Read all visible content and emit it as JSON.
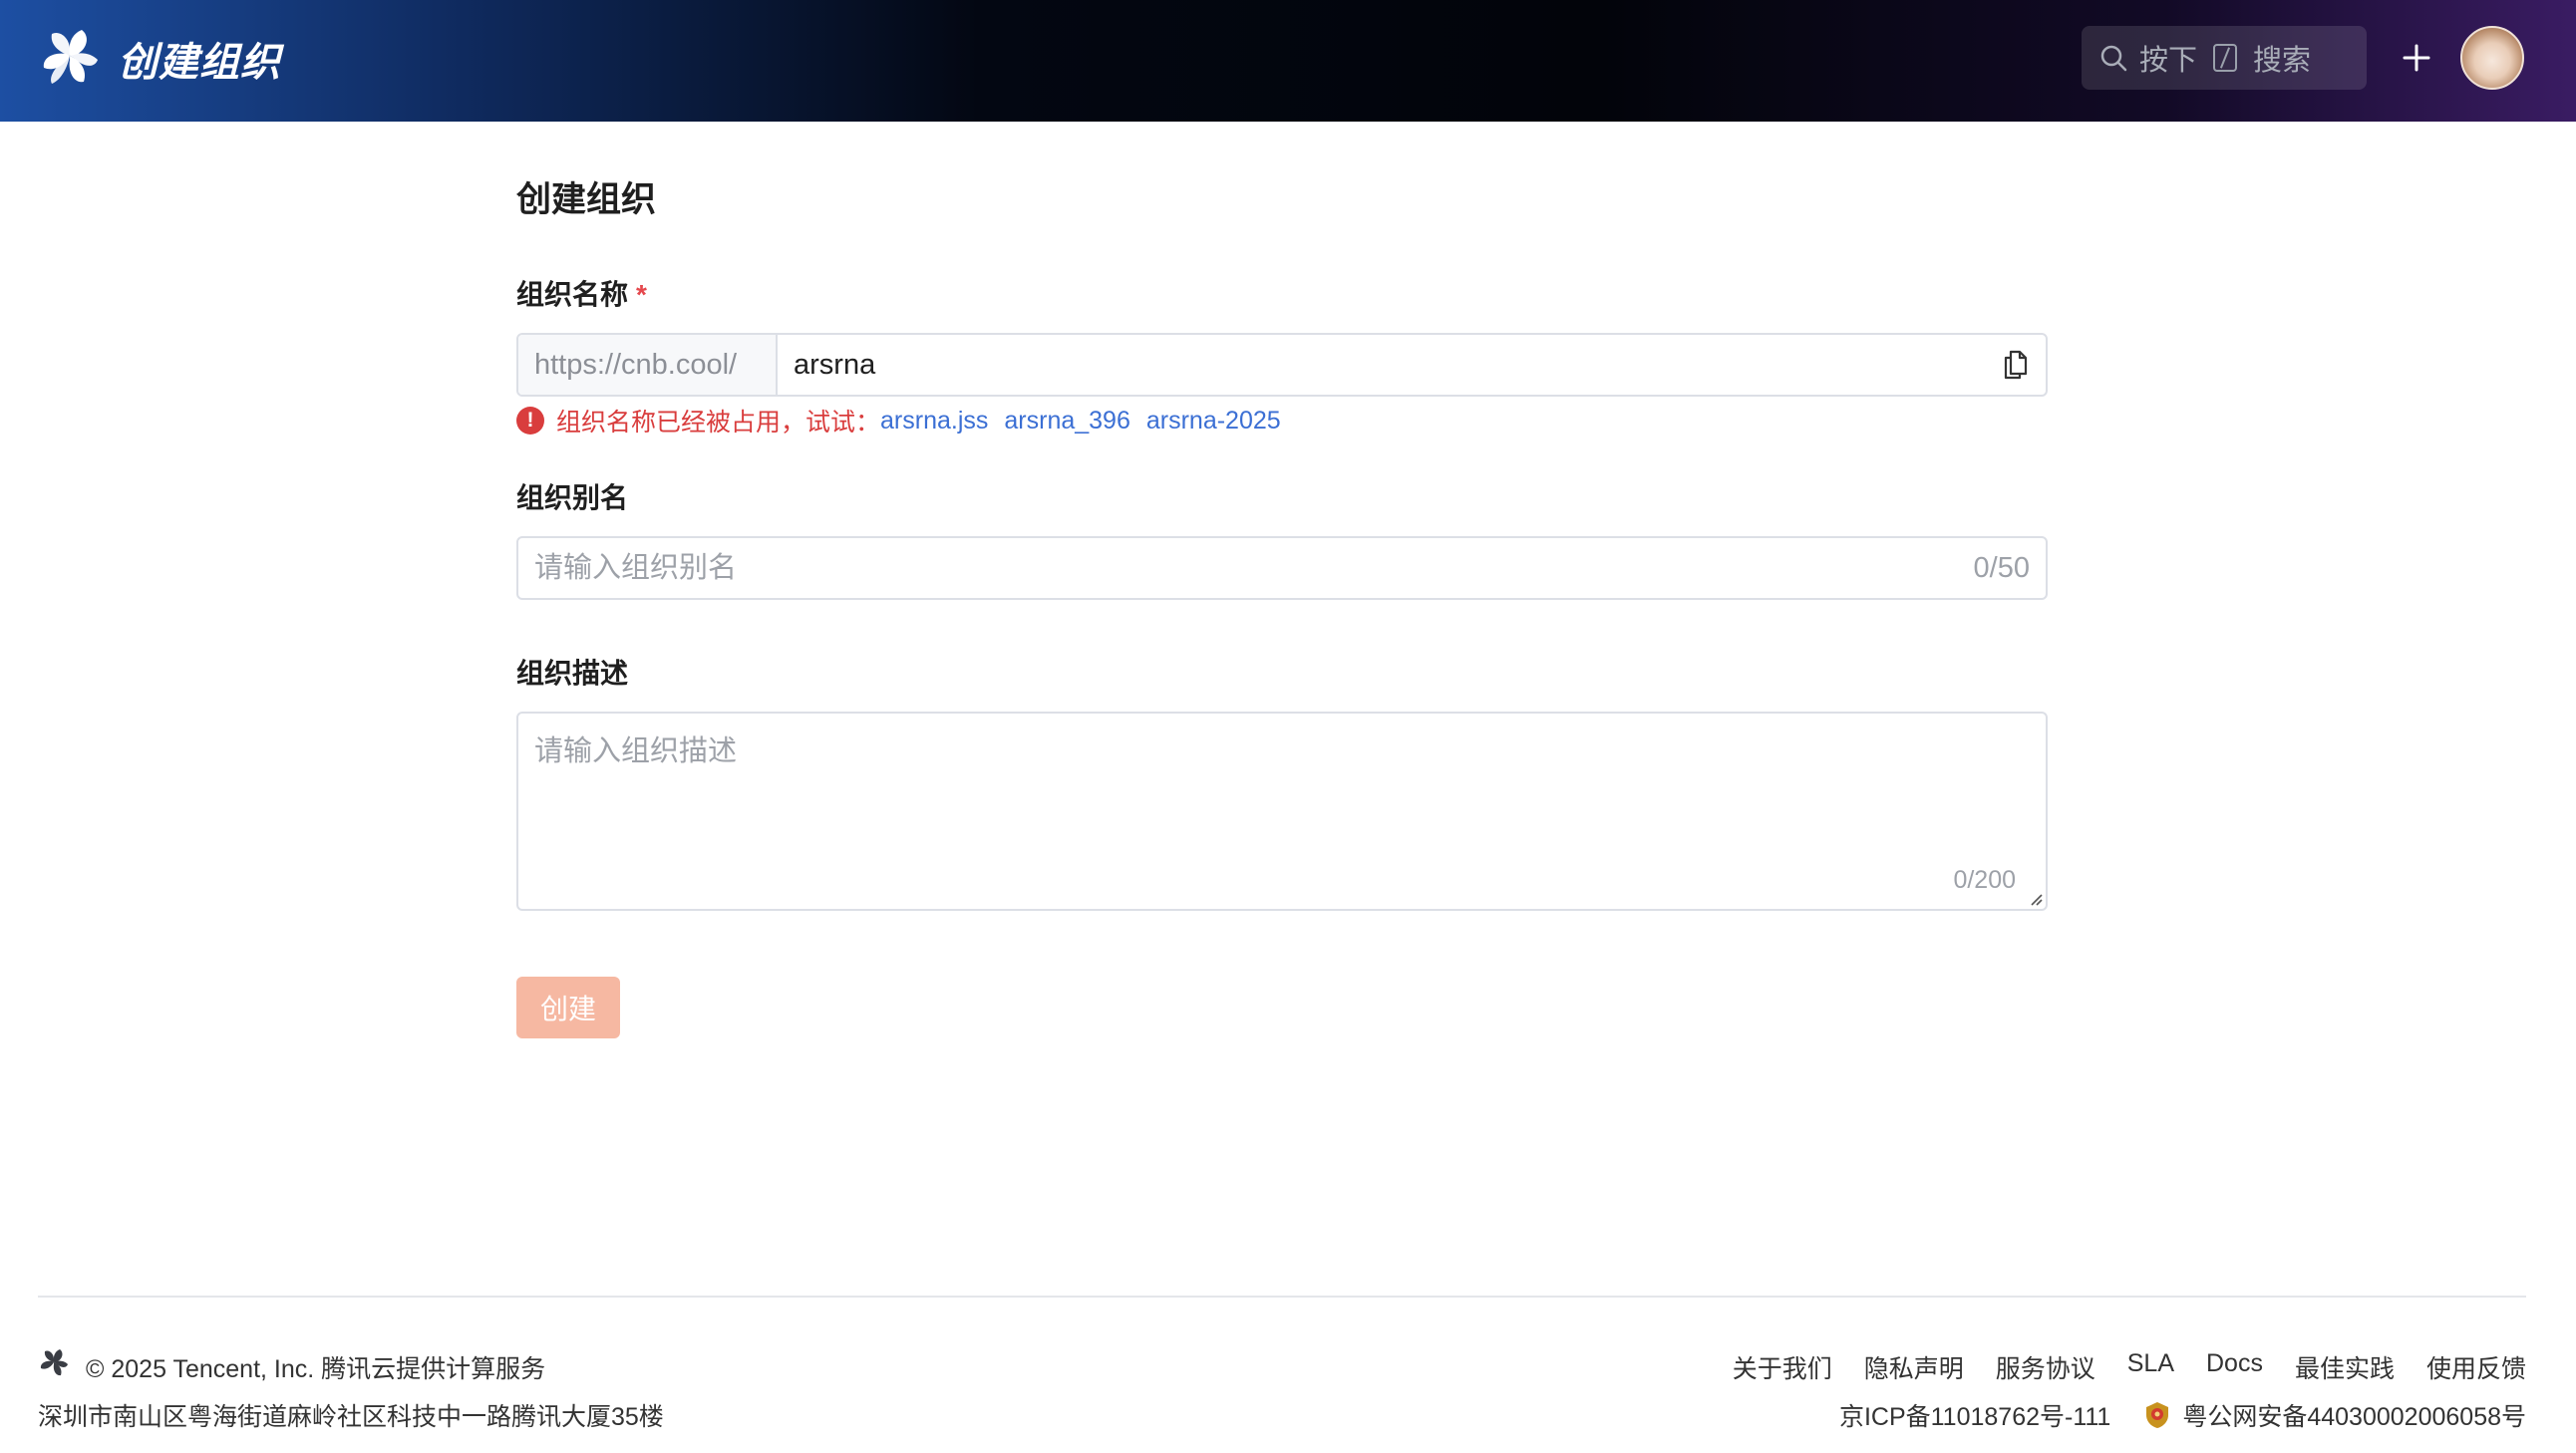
{
  "header": {
    "title": "创建组织",
    "logo_icon": "cnb-logo-icon",
    "search": {
      "prefix": "按下",
      "key": "/",
      "suffix": "搜索"
    },
    "add_icon": "plus-icon",
    "avatar_icon": "avatar"
  },
  "form": {
    "page_title": "创建组织",
    "name": {
      "label": "组织名称",
      "required_mark": "*",
      "prefix": "https://cnb.cool/",
      "value": "arsrna",
      "copy_icon": "copy-icon",
      "error": {
        "icon_glyph": "!",
        "message": "组织名称已经被占用，试试：",
        "suggestions": [
          "arsrna.jss",
          "arsrna_396",
          "arsrna-2025"
        ]
      }
    },
    "alias": {
      "label": "组织别名",
      "placeholder": "请输入组织别名",
      "value": "",
      "counter": "0/50"
    },
    "description": {
      "label": "组织描述",
      "placeholder": "请输入组织描述",
      "value": "",
      "counter": "0/200"
    },
    "submit_label": "创建"
  },
  "footer": {
    "copyright": "© 2025 Tencent, Inc. 腾讯云提供计算服务",
    "address": "深圳市南山区粤海街道麻岭社区科技中一路腾讯大厦35楼",
    "links": [
      "关于我们",
      "隐私声明",
      "服务协议",
      "SLA",
      "Docs",
      "最佳实践",
      "使用反馈"
    ],
    "icp": "京ICP备11018762号-111",
    "police": "粤公网安备44030002006058号"
  },
  "colors": {
    "error": "#d93d3d",
    "link": "#3b6fd4",
    "button_disabled": "#f6b8a2",
    "border": "#dcdfe6"
  }
}
